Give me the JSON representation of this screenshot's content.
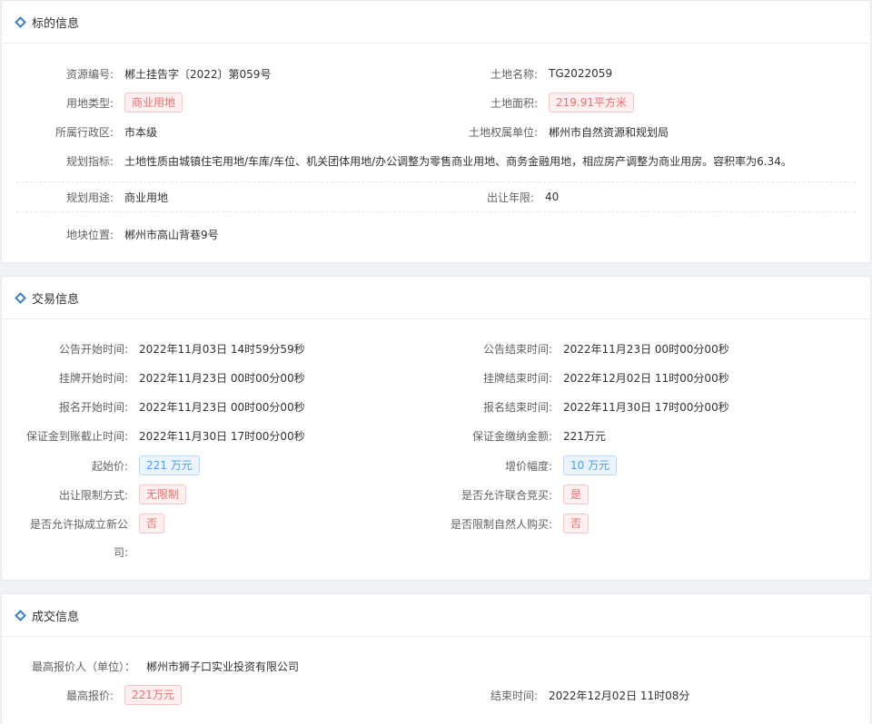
{
  "section1": {
    "title": "标的信息",
    "resource_no": {
      "label": "资源编号:",
      "value": "郴土挂告字〔2022〕第059号"
    },
    "land_name": {
      "label": "土地名称:",
      "value": "TG2022059"
    },
    "land_type": {
      "label": "用地类型:",
      "value": "商业用地"
    },
    "land_area": {
      "label": "土地面积:",
      "value": "219.91平方米"
    },
    "district": {
      "label": "所属行政区:",
      "value": "市本级"
    },
    "owner_unit": {
      "label": "土地权属单位:",
      "value": "郴州市自然资源和规划局"
    },
    "planning_index": {
      "label": "规划指标:",
      "value": "土地性质由城镇住宅用地/车库/车位、机关团体用地/办公调整为零售商业用地、商务金融用地，相应房产调整为商业用房。容积率为6.34。"
    },
    "planning_use": {
      "label": "规划用途:",
      "value": "商业用地"
    },
    "transfer_years": {
      "label": "出让年限:",
      "value": "40"
    },
    "location": {
      "label": "地块位置:",
      "value": "郴州市高山背巷9号"
    }
  },
  "section2": {
    "title": "交易信息",
    "notice_start": {
      "label": "公告开始时间:",
      "value": "2022年11月03日 14时59分59秒"
    },
    "notice_end": {
      "label": "公告结束时间:",
      "value": "2022年11月23日 00时00分00秒"
    },
    "listing_start": {
      "label": "挂牌开始时间:",
      "value": "2022年11月23日 00时00分00秒"
    },
    "listing_end": {
      "label": "挂牌结束时间:",
      "value": "2022年12月02日 11时00分00秒"
    },
    "signup_start": {
      "label": "报名开始时间:",
      "value": "2022年11月23日 00时00分00秒"
    },
    "signup_end": {
      "label": "报名结束时间:",
      "value": "2022年11月30日 17时00分00秒"
    },
    "deposit_deadline": {
      "label": "保证金到账截止时间:",
      "value": "2022年11月30日 17时00分00秒"
    },
    "deposit_amount": {
      "label": "保证金缴纳金额:",
      "value": "221万元"
    },
    "start_price": {
      "label": "起始价:",
      "value": "221 万元"
    },
    "increment": {
      "label": "增价幅度:",
      "value": "10 万元"
    },
    "restriction": {
      "label": "出让限制方式:",
      "value": "无限制"
    },
    "joint_bid": {
      "label": "是否允许联合竞买:",
      "value": "是"
    },
    "new_company_l1": "是否允许拟成立新公",
    "new_company_l2": "司:",
    "new_company_value": "否",
    "natural_person": {
      "label": "是否限制自然人购买:",
      "value": "否"
    }
  },
  "section3": {
    "title": "成交信息",
    "top_bidder": {
      "label": "最高报价人（单位）：",
      "value": "郴州市狮子口实业投资有限公司"
    },
    "top_price": {
      "label": "最高报价:",
      "value": "221万元"
    },
    "end_time": {
      "label": "结束时间:",
      "value": "2022年12月02日 11时08分"
    }
  }
}
